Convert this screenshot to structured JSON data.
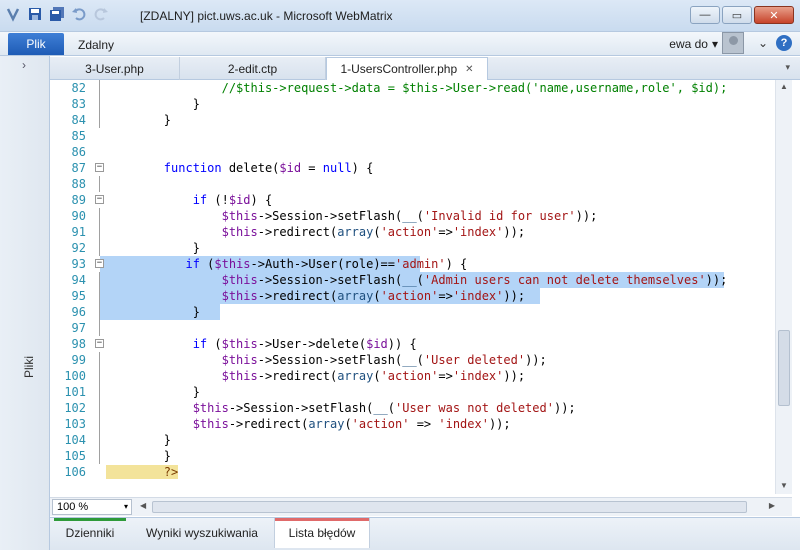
{
  "window": {
    "title": "[ZDALNY] pict.uws.ac.uk - Microsoft WebMatrix",
    "minimize_glyph": "—",
    "maximize_glyph": "▭",
    "close_glyph": "✕"
  },
  "qat": {
    "icons": [
      "webmatrix-logo-icon",
      "save-icon",
      "save-all-icon",
      "undo-icon",
      "redo-icon"
    ]
  },
  "ribbon": {
    "file_tab": "Plik",
    "tab": "Zdalny",
    "user_name": "ewa do",
    "user_dropdown": "▾",
    "collapse_glyph": "⌄",
    "help_glyph": "?"
  },
  "sidepane": {
    "chevron": "›",
    "label": "Pliki"
  },
  "file_tabs": [
    {
      "label": "3-User.php",
      "active": false
    },
    {
      "label": "2-edit.ctp",
      "active": false
    },
    {
      "label": "1-UsersController.php",
      "active": true,
      "close": "✕"
    }
  ],
  "tabs_dropdown": "▾",
  "editor": {
    "lines": [
      {
        "n": "82",
        "code": "        //$this->request->data = $this->User->read('name,username,role', $id);"
      },
      {
        "n": "83",
        "code": "    }"
      },
      {
        "n": "84",
        "code": "}"
      },
      {
        "n": "85",
        "code": ""
      },
      {
        "n": "86",
        "code": ""
      },
      {
        "n": "87",
        "code": "function delete($id = null) {"
      },
      {
        "n": "88",
        "code": ""
      },
      {
        "n": "89",
        "code": "    if (!$id) {"
      },
      {
        "n": "90",
        "code": "        $this->Session->setFlash(__('Invalid id for user'));"
      },
      {
        "n": "91",
        "code": "        $this->redirect(array('action'=>'index'));"
      },
      {
        "n": "92",
        "code": "    }"
      },
      {
        "n": "93",
        "code": "   if ($this->Auth->User(role)=='admin') {"
      },
      {
        "n": "94",
        "code": "        $this->Session->setFlash(__('Admin users can not delete themselves'));"
      },
      {
        "n": "95",
        "code": "        $this->redirect(array('action'=>'index'));"
      },
      {
        "n": "96",
        "code": "    }"
      },
      {
        "n": "97",
        "code": ""
      },
      {
        "n": "98",
        "code": "    if ($this->User->delete($id)) {"
      },
      {
        "n": "99",
        "code": "        $this->Session->setFlash(__('User deleted'));"
      },
      {
        "n": "100",
        "code": "        $this->redirect(array('action'=>'index'));"
      },
      {
        "n": "101",
        "code": "    }"
      },
      {
        "n": "102",
        "code": "    $this->Session->setFlash(__('User was not deleted'));"
      },
      {
        "n": "103",
        "code": "    $this->redirect(array('action' => 'index'));"
      },
      {
        "n": "104",
        "code": "}"
      },
      {
        "n": "105",
        "code": "}"
      },
      {
        "n": "106",
        "code": "?>"
      }
    ]
  },
  "zoom": {
    "value": "100 %",
    "dropdown": "▾"
  },
  "scroll": {
    "up": "▲",
    "down": "▼",
    "left": "◀",
    "right": "▶"
  },
  "bottom_tabs": [
    {
      "label": "Dzienniki",
      "color": "#2e9a3a",
      "active": false
    },
    {
      "label": "Wyniki wyszukiwania",
      "color": "",
      "active": false
    },
    {
      "label": "Lista błędów",
      "color": "#e06a6a",
      "active": true
    }
  ]
}
